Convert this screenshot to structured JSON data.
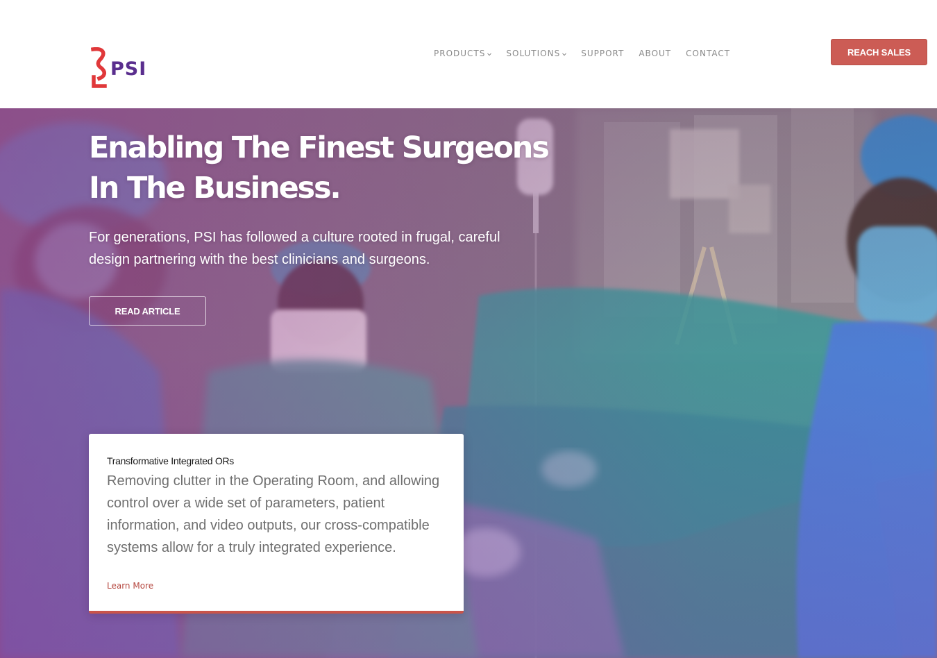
{
  "brand": {
    "name": "PSI",
    "logo_mark_icon": "psi-ribbon-mark-icon",
    "mark_color": "#e0383a",
    "text_color": "#5a2e8e"
  },
  "nav": {
    "items": [
      {
        "label": "PRODUCTS",
        "has_dropdown": true,
        "icon": "chevron-down-icon"
      },
      {
        "label": "SOLUTIONS",
        "has_dropdown": true,
        "icon": "chevron-down-icon"
      },
      {
        "label": "SUPPORT",
        "has_dropdown": false
      },
      {
        "label": "ABOUT",
        "has_dropdown": false
      },
      {
        "label": "CONTACT",
        "has_dropdown": false
      }
    ],
    "text_color": "#8a8a8a"
  },
  "header_cta": {
    "label": "REACH SALES",
    "bg_color": "#cc5c55"
  },
  "hero": {
    "title_line1": "Enabling The Finest Surgeons",
    "title_line2": "In The Business.",
    "subtitle": "For generations, PSI has followed a culture rooted in frugal, careful design partnering with the best clinicians and surgeons.",
    "button_label": "READ ARTICLE",
    "background_image": "operating-room-photo"
  },
  "feature_card": {
    "title": "Transformative Integrated ORs",
    "body": "Removing clutter in the Operating Room, and allowing control over a wide set of parameters, patient information, and video outputs, our cross-compatible systems allow for a truly integrated experience.",
    "link_label": "Learn More",
    "accent_color": "#c9544a"
  }
}
